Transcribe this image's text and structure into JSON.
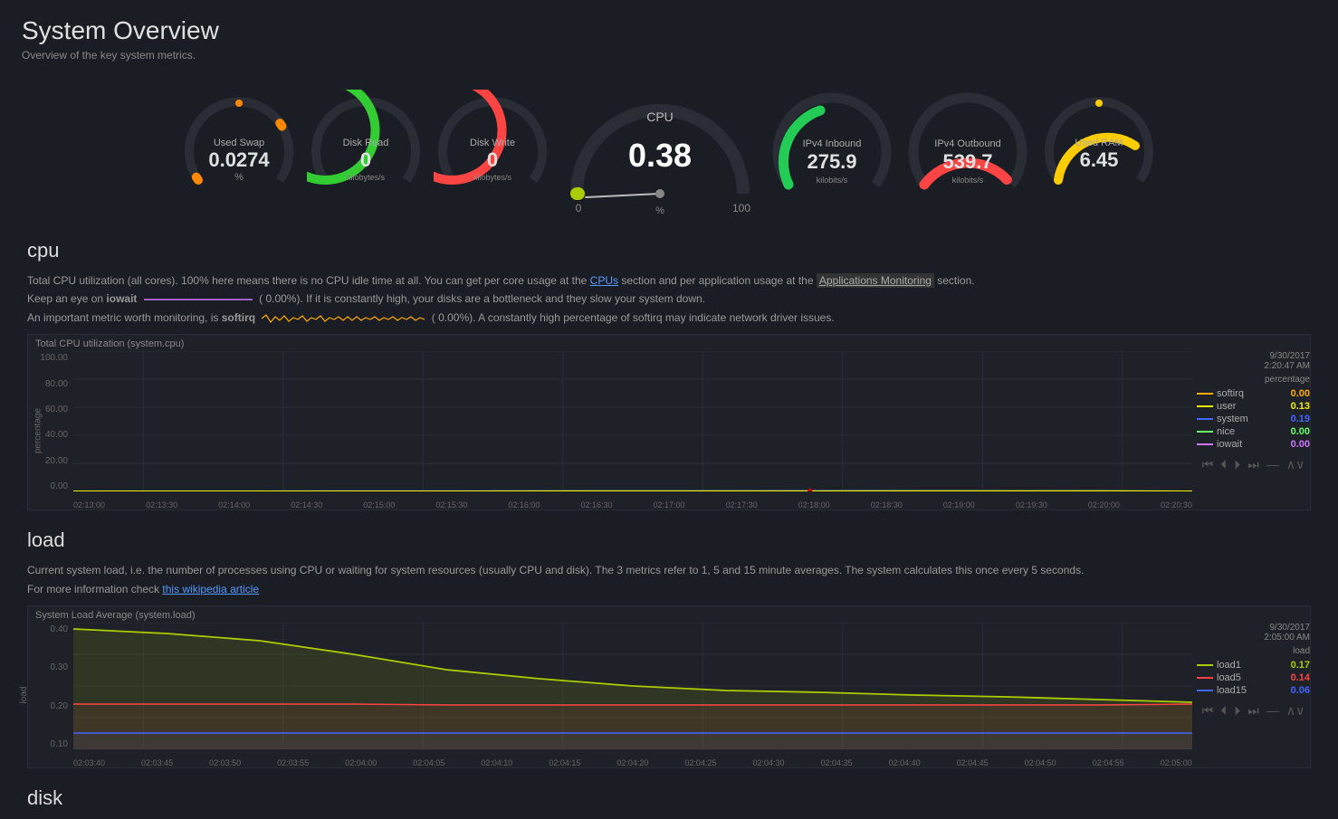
{
  "header": {
    "title": "System Overview",
    "subtitle": "Overview of the key system metrics."
  },
  "gauges": {
    "used_swap": {
      "label": "Used Swap",
      "value": "0.0274",
      "unit": "%",
      "color": "#ff8800",
      "arc_pct": 2
    },
    "disk_read": {
      "label": "Disk Read",
      "value": "0",
      "unit": "kilobytes/s",
      "color": "#33cc33",
      "arc_pct": 0
    },
    "disk_write": {
      "label": "Disk Write",
      "value": "0",
      "unit": "kilobytes/s",
      "color": "#ff4444",
      "arc_pct": 0
    },
    "cpu": {
      "label": "CPU",
      "value": "0.38",
      "unit": "%",
      "min": "0",
      "max": "100",
      "needle_pct": 0.38
    },
    "ipv4_inbound": {
      "label": "IPv4 Inbound",
      "value": "275.9",
      "unit": "kilobits/s",
      "color": "#22cc55",
      "arc_pct": 28
    },
    "ipv4_outbound": {
      "label": "IPv4 Outbound",
      "value": "539.7",
      "unit": "kilobits/s",
      "color": "#ff4444",
      "arc_pct": 55
    },
    "used_ram": {
      "label": "Used RAM",
      "value": "6.45",
      "unit": "",
      "color": "#ffcc00",
      "arc_pct": 65
    }
  },
  "cpu_section": {
    "title": "cpu",
    "chart_title": "Total CPU utilization (system.cpu)",
    "desc_line1": "Total CPU utilization (all cores). 100% here means there is no CPU idle time at all. You can get per core usage at the ",
    "cpus_link": "CPUs",
    "desc_mid": " section and per application usage at the ",
    "app_link": "Applications Monitoring",
    "desc_end": " section.",
    "iowait_line": "Keep an eye on ",
    "iowait_word": "iowait",
    "iowait_pct": "0.00%",
    "iowait_desc": ". If it is constantly high, your disks are a bottleneck and they slow your system down.",
    "softirq_line": "An important metric worth monitoring, is ",
    "softirq_word": "softirq",
    "softirq_pct": "0.00%",
    "softirq_desc": ". A constantly high percentage of softirq may indicate network driver issues.",
    "timestamp": "9/30/2017\n2:20:47 AM",
    "legend_header": "percentage",
    "legend": [
      {
        "name": "softirq",
        "color": "#ffaa00",
        "value": "0.00"
      },
      {
        "name": "user",
        "color": "#eeee00",
        "value": "0.13"
      },
      {
        "name": "system",
        "color": "#4466ff",
        "value": "0.19"
      },
      {
        "name": "nice",
        "color": "#66ff66",
        "value": "0.00"
      },
      {
        "name": "iowait",
        "color": "#cc77ff",
        "value": "0.00"
      }
    ],
    "x_labels": [
      "02:13:00",
      "02:13:30",
      "02:14:00",
      "02:14:30",
      "02:15:00",
      "02:15:30",
      "02:16:00",
      "02:16:30",
      "02:17:00",
      "02:17:30",
      "02:18:00",
      "02:18:30",
      "02:19:00",
      "02:19:30",
      "02:20:00",
      "02:20:30"
    ],
    "y_labels": [
      "100.00",
      "80.00",
      "60.00",
      "40.00",
      "20.00",
      "0.00"
    ]
  },
  "load_section": {
    "title": "load",
    "chart_title": "System Load Average (system.load)",
    "desc_line1": "Current system load, i.e. the number of processes using CPU or waiting for system resources (usually CPU and disk). The 3 metrics refer to 1, 5 and 15 minute averages. The system calculates this once every 5 seconds.",
    "desc_line2": "For more information check ",
    "wiki_link": "this wikipedia article",
    "timestamp": "9/30/2017\n2:05:00 AM",
    "legend_header": "load",
    "legend": [
      {
        "name": "load1",
        "color": "#aacc00",
        "value": "0.17"
      },
      {
        "name": "load5",
        "color": "#ff4444",
        "value": "0.14"
      },
      {
        "name": "load15",
        "color": "#4466ff",
        "value": "0.06"
      }
    ],
    "x_labels": [
      "02:03:40",
      "02:03:45",
      "02:03:50",
      "02:03:55",
      "02:04:00",
      "02:04:05",
      "02:04:10",
      "02:04:15",
      "02:04:20",
      "02:04:25",
      "02:04:30",
      "02:04:35",
      "02:04:40",
      "02:04:45",
      "02:04:50",
      "02:04:55",
      "02:05:00"
    ],
    "y_labels": [
      "0.40",
      "0.30",
      "0.20",
      "0.10"
    ]
  }
}
